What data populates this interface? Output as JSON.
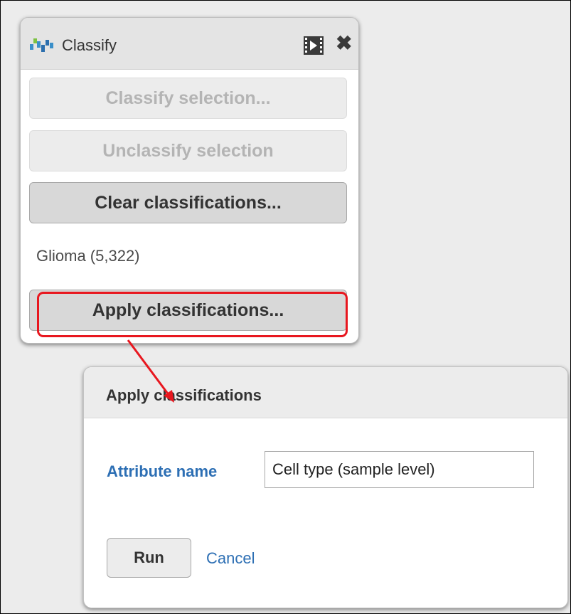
{
  "classify_panel": {
    "title": "Classify",
    "buttons": {
      "classify_selection": "Classify selection...",
      "unclassify_selection": "Unclassify selection",
      "clear_classifications": "Clear classifications...",
      "apply_classifications": "Apply classifications..."
    },
    "classes": [
      {
        "label": "Glioma (5,322)"
      }
    ],
    "icons": {
      "logo": "classify-logo-icon",
      "video": "video-icon",
      "close": "close-icon"
    }
  },
  "apply_dialog": {
    "title": "Apply classifications",
    "attribute_label": "Attribute name",
    "attribute_value": "Cell type (sample level)",
    "run_label": "Run",
    "cancel_label": "Cancel"
  },
  "annotation": {
    "highlight_color": "#e8171f",
    "arrow_color": "#e8171f"
  },
  "colors": {
    "link_blue": "#2d6fb4",
    "header_gray": "#e4e4e4"
  }
}
